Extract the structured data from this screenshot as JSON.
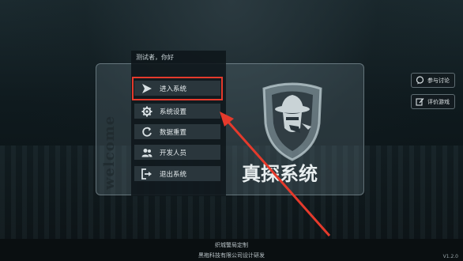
{
  "greeting": "测试者，你好",
  "welcome_text": "welcome",
  "menu": [
    {
      "label": "进入系统",
      "icon": "play-arrow-icon"
    },
    {
      "label": "系统设置",
      "icon": "gear-icon"
    },
    {
      "label": "数据重置",
      "icon": "refresh-icon"
    },
    {
      "label": "开发人员",
      "icon": "users-icon"
    },
    {
      "label": "退出系统",
      "icon": "exit-icon"
    }
  ],
  "brand": {
    "title": "真探系统",
    "logo_icon": "detective-shield-logo"
  },
  "side_buttons": [
    {
      "label": "参与讨论",
      "icon": "chat-icon"
    },
    {
      "label": "评价游戏",
      "icon": "edit-icon"
    }
  ],
  "footer": {
    "line1": "织城警局定制",
    "line2": "黑袍科技有限公司设计研发",
    "version": "V1.2.0"
  },
  "colors": {
    "highlight": "#e53a2c",
    "annotation_arrow": "#e53a2c"
  }
}
